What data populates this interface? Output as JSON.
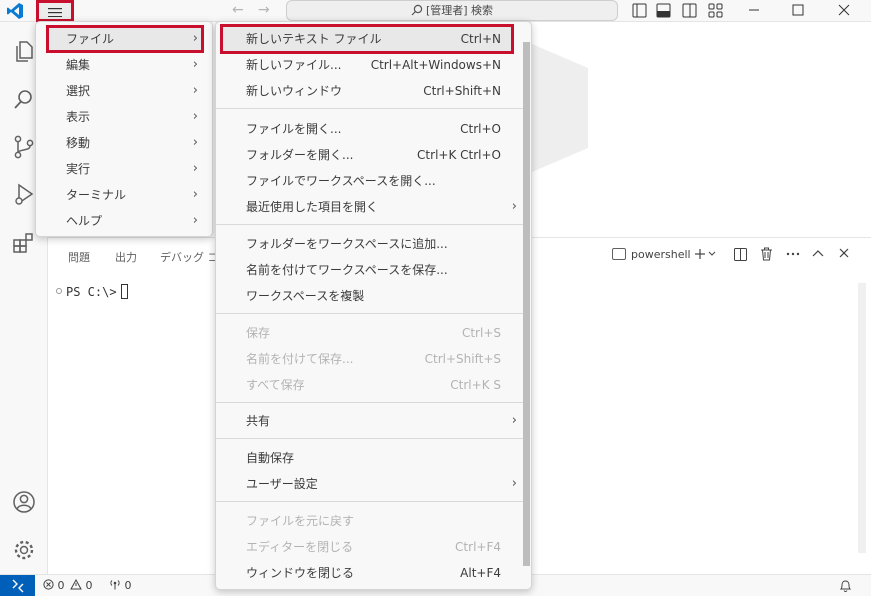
{
  "titlebar": {
    "search_text": "[管理者] 検索",
    "nav_back": "←",
    "nav_forward": "→"
  },
  "main_menu": {
    "items": [
      {
        "label": "ファイル"
      },
      {
        "label": "編集"
      },
      {
        "label": "選択"
      },
      {
        "label": "表示"
      },
      {
        "label": "移動"
      },
      {
        "label": "実行"
      },
      {
        "label": "ターミナル"
      },
      {
        "label": "ヘルプ"
      }
    ]
  },
  "file_menu": {
    "items": [
      {
        "label": "新しいテキスト ファイル",
        "shortcut": "Ctrl+N"
      },
      {
        "label": "新しいファイル...",
        "shortcut": "Ctrl+Alt+Windows+N"
      },
      {
        "label": "新しいウィンドウ",
        "shortcut": "Ctrl+Shift+N"
      },
      {
        "label": "ファイルを開く...",
        "shortcut": "Ctrl+O"
      },
      {
        "label": "フォルダーを開く...",
        "shortcut": "Ctrl+K Ctrl+O"
      },
      {
        "label": "ファイルでワークスペースを開く...",
        "shortcut": ""
      },
      {
        "label": "最近使用した項目を開く",
        "shortcut": ""
      },
      {
        "label": "フォルダーをワークスペースに追加...",
        "shortcut": ""
      },
      {
        "label": "名前を付けてワークスペースを保存...",
        "shortcut": ""
      },
      {
        "label": "ワークスペースを複製",
        "shortcut": ""
      },
      {
        "label": "保存",
        "shortcut": "Ctrl+S"
      },
      {
        "label": "名前を付けて保存...",
        "shortcut": "Ctrl+Shift+S"
      },
      {
        "label": "すべて保存",
        "shortcut": "Ctrl+K S"
      },
      {
        "label": "共有",
        "shortcut": ""
      },
      {
        "label": "自動保存",
        "shortcut": ""
      },
      {
        "label": "ユーザー設定",
        "shortcut": ""
      },
      {
        "label": "ファイルを元に戻す",
        "shortcut": ""
      },
      {
        "label": "エディターを閉じる",
        "shortcut": "Ctrl+F4"
      },
      {
        "label": "ウィンドウを閉じる",
        "shortcut": "Alt+F4"
      }
    ]
  },
  "panel": {
    "tabs": [
      "問題",
      "出力",
      "デバッグ コン"
    ],
    "terminal_name": "powershell",
    "prompt": "PS C:\\>"
  },
  "statusbar": {
    "errors": "0",
    "warnings": "0",
    "ports": "0"
  },
  "colors": {
    "highlight_border": "#c8102e",
    "accent": "#005fb8"
  }
}
